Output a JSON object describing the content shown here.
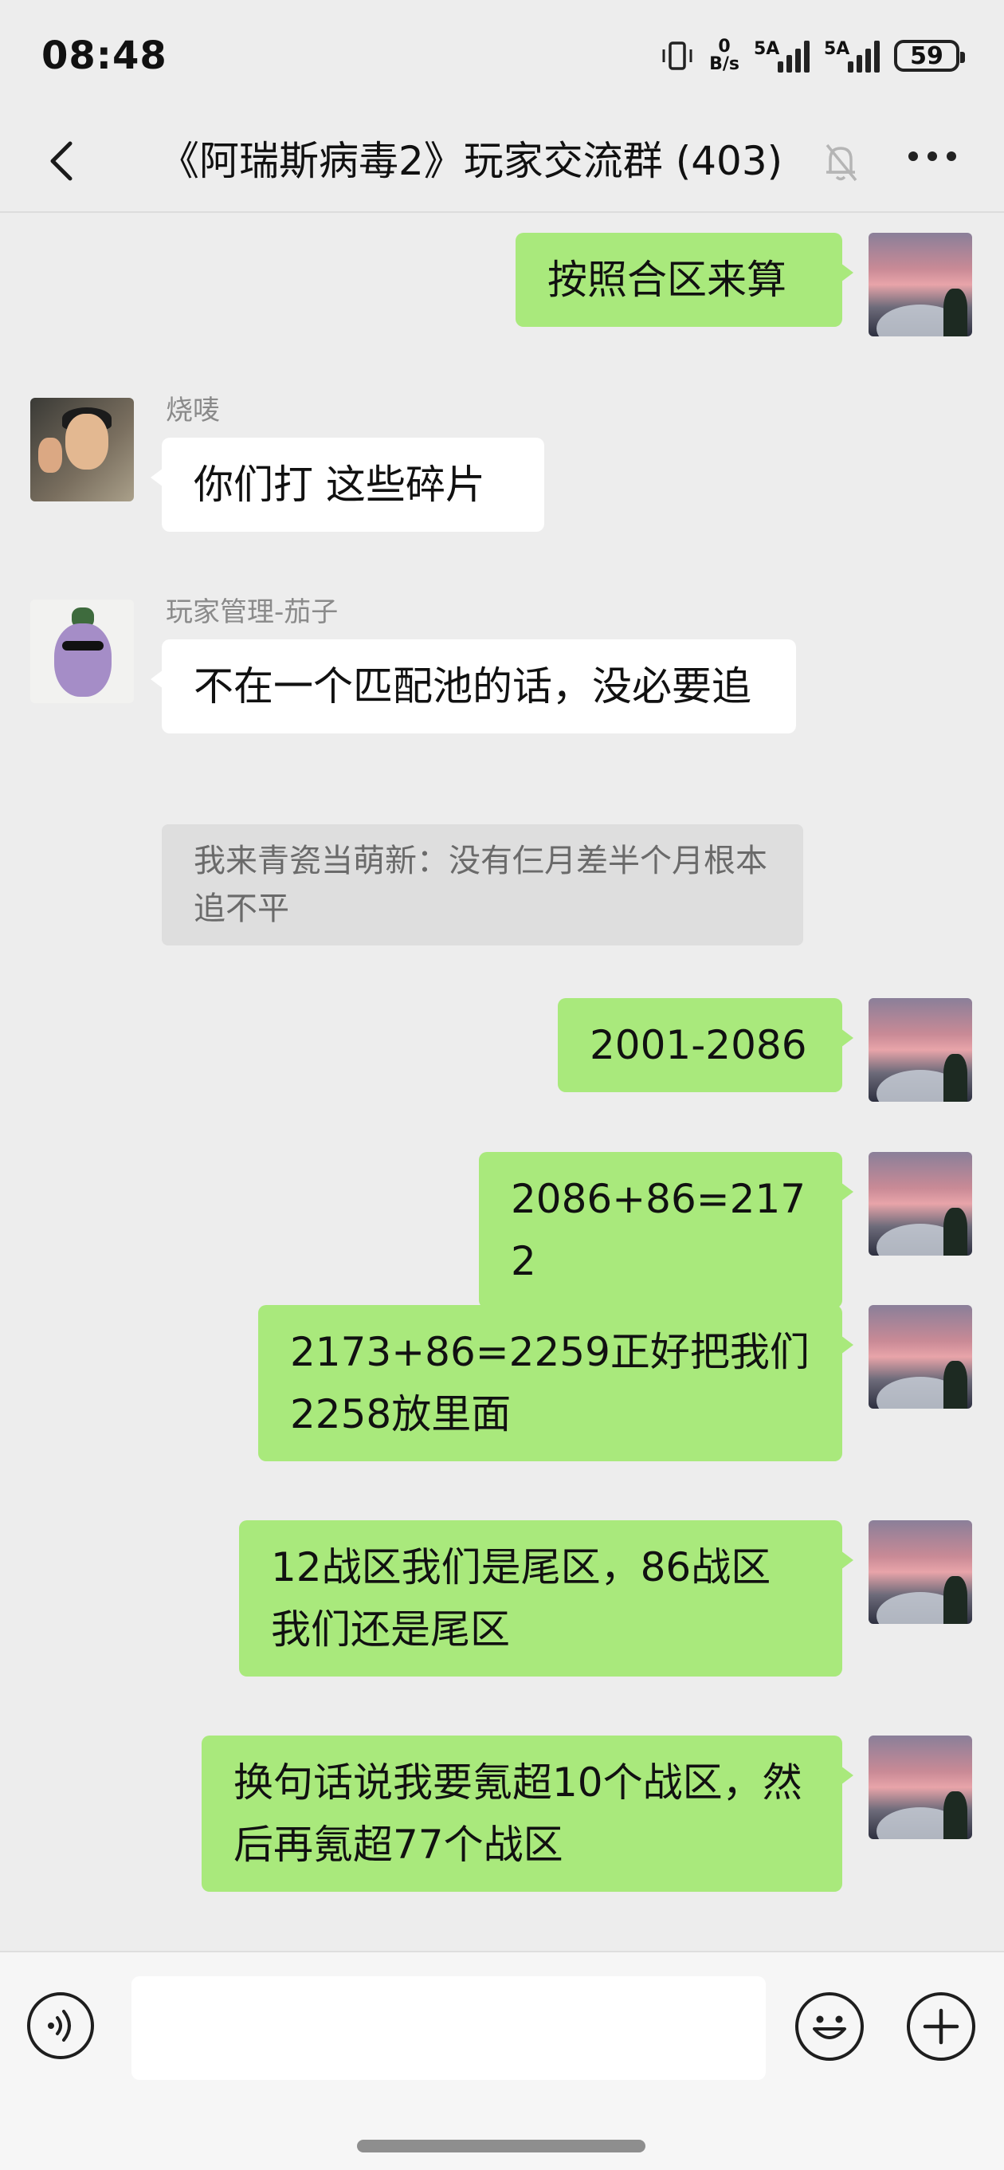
{
  "status_bar": {
    "time": "08:48",
    "net_speed_value": "0",
    "net_speed_unit": "B/s",
    "signal_1_label": "5A",
    "signal_2_label": "5A",
    "battery": "59"
  },
  "header": {
    "title": "《阿瑞斯病毒2》玩家交流群 (403)",
    "muted_icon": "bell-off-icon",
    "more_icon": "more-icon",
    "back_icon": "chevron-left-icon"
  },
  "messages": [
    {
      "from": "me",
      "text": "按照合区来算"
    },
    {
      "from": "other",
      "sender": "烧唛",
      "text": "你们打 这些碎片"
    },
    {
      "from": "other",
      "sender": "玩家管理-茄子",
      "text": "不在一个匹配池的话，没必要追",
      "quote": "我来青瓷当萌新：没有仨月差半个月根本追不平"
    },
    {
      "from": "me",
      "text": "2001-2086"
    },
    {
      "from": "me",
      "text": "2086+86=2172"
    },
    {
      "from": "me",
      "text": "2173+86=2259正好把我们2258放里面"
    },
    {
      "from": "me",
      "text": "12战区我们是尾区，86战区我们还是尾区"
    },
    {
      "from": "me",
      "text": "换句话说我要氪超10个战区，然后再氪超77个战区"
    }
  ],
  "input_bar": {
    "voice_icon": "voice-icon",
    "input_value": "",
    "emoji_icon": "smiley-icon",
    "plus_icon": "plus-icon"
  },
  "colors": {
    "background": "#ededed",
    "my_bubble": "#a9e97c",
    "other_bubble": "#ffffff",
    "quote_bg": "#dedede"
  }
}
